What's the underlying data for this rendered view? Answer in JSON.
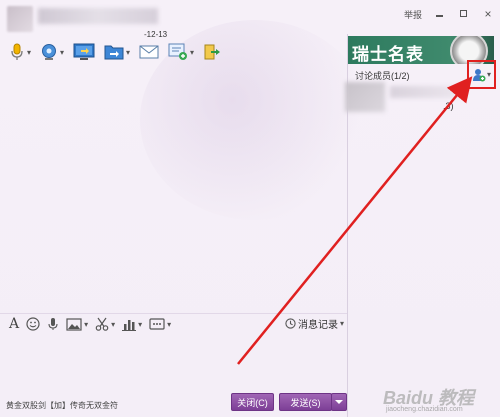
{
  "title_bar": {
    "subtitle": "-12-13",
    "report_label": "举报",
    "close_glyph": "×"
  },
  "toolbar": {
    "items": [
      {
        "icon": "microphone-icon",
        "has_dropdown": true
      },
      {
        "icon": "webcam-icon",
        "has_dropdown": true
      },
      {
        "icon": "screen-share-icon",
        "has_dropdown": false
      },
      {
        "icon": "file-transfer-icon",
        "has_dropdown": true
      },
      {
        "icon": "email-icon",
        "has_dropdown": false
      },
      {
        "icon": "app-add-icon",
        "has_dropdown": true
      },
      {
        "icon": "exit-group-icon",
        "has_dropdown": false
      }
    ]
  },
  "ad_banner": {
    "text": "瑞士名表"
  },
  "side_panel": {
    "members_title": "讨论成员(1/2)",
    "member_count_fragment": ".3)"
  },
  "input_toolbar": {
    "items": [
      {
        "icon": "font-icon",
        "glyph": "A"
      },
      {
        "icon": "emoji-icon"
      },
      {
        "icon": "voice-message-icon"
      },
      {
        "icon": "image-icon",
        "has_dropdown": true
      },
      {
        "icon": "scissors-icon",
        "has_dropdown": true
      },
      {
        "icon": "bar-chart-icon",
        "has_dropdown": true
      },
      {
        "icon": "more-apps-icon",
        "has_dropdown": true
      }
    ],
    "history_label": "消息记录"
  },
  "footer": {
    "promo_text": "黄金双股剑【加】传奇无双金符",
    "close_button": "关闭(C)",
    "send_button": "发送(S)"
  },
  "watermark": {
    "text": "Baidu 教程",
    "url": "jiaocheng.chazidian.com"
  },
  "colors": {
    "button": "#8a4aa3",
    "highlight": "#e02020",
    "banner": "#2d7a5e",
    "window_bg": "#f4eef7"
  }
}
